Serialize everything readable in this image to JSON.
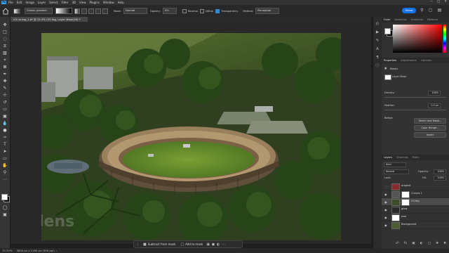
{
  "app": {
    "menu": [
      "File",
      "Edit",
      "Image",
      "Layer",
      "Select",
      "Filter",
      "3D",
      "View",
      "Plugins",
      "Window",
      "Help"
    ],
    "logo_text": "Ps"
  },
  "options": {
    "gradient_label": "Classic gradient",
    "mode_label": "Mode:",
    "mode_value": "Normal",
    "opacity_label": "Opacity:",
    "opacity_value": "0%",
    "reverse_label": "Reverse",
    "dither_label": "Dither",
    "transparency_label": "Transparency",
    "method_label": "Method:",
    "method_value": "Perceptual",
    "share_label": "Share"
  },
  "document": {
    "tab_title": "V3 no fog_1.tif @ 15.3% (V3 fog, Layer Mask/16) *",
    "watermark": "lens"
  },
  "context_bar": {
    "subtract_label": "Subtract from mask",
    "add_label": "Add to mask"
  },
  "status": {
    "zoom": "15.32%",
    "size": "3840 px x 2160 px (300 ppi)"
  },
  "color_panel": {
    "tabs": [
      "Color",
      "Swatches",
      "Gradients",
      "Patterns"
    ]
  },
  "properties_panel": {
    "tabs": [
      "Properties",
      "Adjustments",
      "Libraries"
    ],
    "masks_label": "Masks",
    "layer_mask_label": "Layer Mask",
    "density_label": "Density:",
    "density_value": "100%",
    "feather_label": "Feather:",
    "feather_value": "0.0 px",
    "refine_label": "Refine:",
    "select_mask_btn": "Select and Mask...",
    "color_range_btn": "Color Range...",
    "invert_btn": "Invert"
  },
  "layers_panel": {
    "tabs": [
      "Layers",
      "Channels",
      "Paths"
    ],
    "kind_value": "Kind",
    "blend_value": "Normal",
    "opacity_label": "Opacity:",
    "opacity_value": "100%",
    "lock_label": "Lock:",
    "fill_label": "Fill:",
    "fill_value": "100%",
    "layers": [
      {
        "name": "original"
      },
      {
        "name": "Curves 1"
      },
      {
        "name": "V3 fog"
      },
      {
        "name": "glow"
      },
      {
        "name": "tree"
      },
      {
        "name": "Background"
      }
    ]
  }
}
